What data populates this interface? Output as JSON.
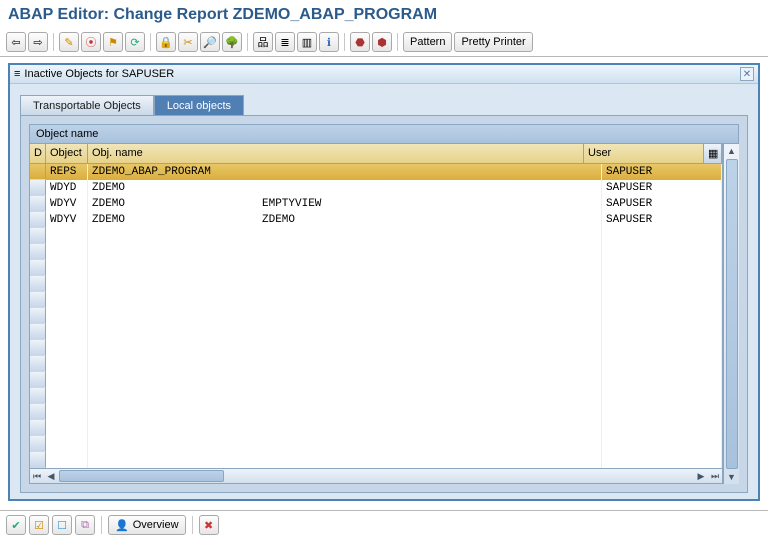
{
  "title": "ABAP Editor: Change Report ZDEMO_ABAP_PROGRAM",
  "toolbar": {
    "pattern_label": "Pattern",
    "pretty_printer_label": "Pretty Printer"
  },
  "dialog": {
    "icon": "list-icon",
    "title": "Inactive Objects for SAPUSER",
    "tabs": {
      "transportable": "Transportable Objects",
      "local": "Local objects"
    },
    "group_label": "Object name",
    "columns": {
      "d": "D",
      "object": "Object",
      "obj_name": "Obj. name",
      "user": "User"
    },
    "rows": [
      {
        "selected": true,
        "object": "REPS",
        "name1": "ZDEMO_ABAP_PROGRAM",
        "name2": "",
        "user": "SAPUSER"
      },
      {
        "selected": false,
        "object": "WDYD",
        "name1": "ZDEMO",
        "name2": "",
        "user": "SAPUSER"
      },
      {
        "selected": false,
        "object": "WDYV",
        "name1": "ZDEMO",
        "name2": "EMPTYVIEW",
        "user": "SAPUSER"
      },
      {
        "selected": false,
        "object": "WDYV",
        "name1": "ZDEMO",
        "name2": "ZDEMO",
        "user": "SAPUSER"
      }
    ],
    "empty_rows": 15
  },
  "bottom": {
    "overview_label": "Overview"
  },
  "icons": {
    "doc": "≡"
  }
}
